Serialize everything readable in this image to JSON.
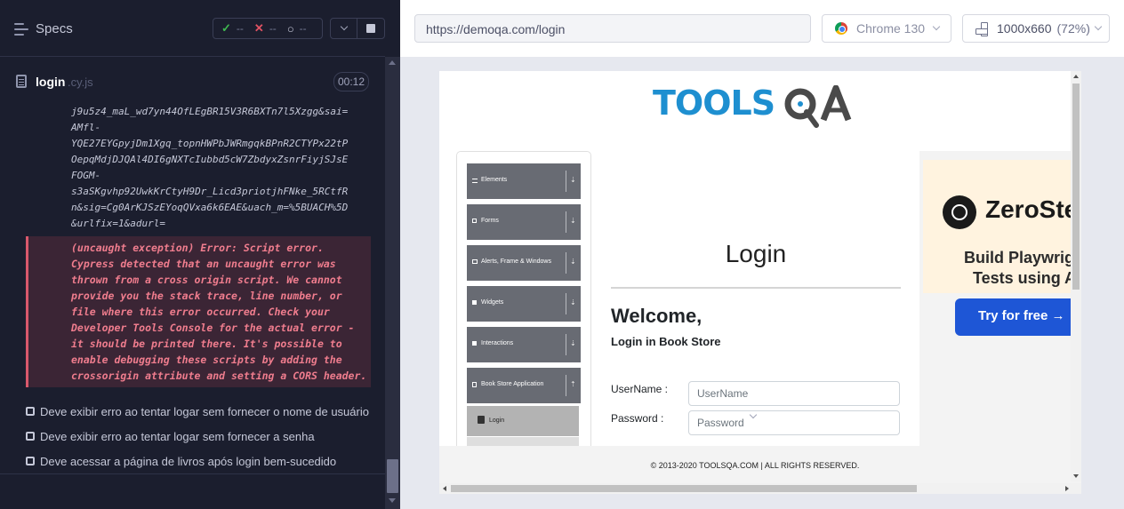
{
  "runner": {
    "title": "Specs",
    "stats": {
      "passed": "--",
      "failed": "--",
      "pending": "--"
    },
    "spec": {
      "name": "login",
      "ext": ".cy.js",
      "timer": "00:12"
    },
    "log_lines": [
      "j9u5z4_maL_wd7yn44OfLEgBR15V3R6BXTn7l5Xzgg&sai=",
      "AMfl-",
      "YQE27EYGpyjDm1Xgq_topnHWPbJWRmgqkBPnR2CTYPx22tP",
      "OepqMdjDJQAl4DI6gNXTcIubbd5cW7ZbdyxZsnrFiyjSJsE",
      "FOGM-",
      "s3aSKgvhp92UwkKrCtyH9Dr_Licd3priotjhFNke_5RCtfR",
      "n&sig=Cg0ArKJSzEYoqQVxa6k6EAE&uach_m=%5BUACH%5D",
      "&urlfix=1&adurl="
    ],
    "error_lines": [
      "(uncaught exception)  Error: Script error.",
      "Cypress detected that an uncaught error was",
      "thrown from a cross origin script. We cannot",
      "provide you the stack trace, line number, or",
      "file where this error occurred. Check your",
      "Developer Tools Console for the actual error -",
      "it should be printed there. It's possible to",
      "enable debugging these scripts by adding the",
      "crossorigin attribute and setting a CORS header."
    ],
    "tests": [
      "Deve exibir erro ao tentar logar sem fornecer o nome de usuário",
      "Deve exibir erro ao tentar logar sem fornecer a senha",
      "Deve acessar a página de livros após login bem-sucedido"
    ],
    "colors": {
      "pass": "#3fb950",
      "fail": "#e05263",
      "pending": "#c5c8d8"
    }
  },
  "preview": {
    "url": "https://demoqa.com/login",
    "browser": "Chrome 130",
    "viewport": "1000x660",
    "scale": "(72%)"
  },
  "app": {
    "logo": {
      "text": "TOOLS",
      "accent": "A"
    },
    "menu": [
      {
        "label": "Elements",
        "icon": "list-icon"
      },
      {
        "label": "Forms",
        "icon": "forms-icon"
      },
      {
        "label": "Alerts, Frame & Windows",
        "icon": "window-icon"
      },
      {
        "label": "Widgets",
        "icon": "grid-icon"
      },
      {
        "label": "Interactions",
        "icon": "grid-icon"
      },
      {
        "label": "Book Store Application",
        "icon": "book-icon"
      }
    ],
    "submenu_active": "Login",
    "page_title": "Login",
    "welcome": "Welcome,",
    "subtitle": "Login in Book Store",
    "fields": {
      "username_label": "UserName :",
      "username_placeholder": "UserName",
      "password_label": "Password :",
      "password_placeholder": "Password"
    },
    "footer": "© 2013-2020 TOOLSQA.COM | ALL RIGHTS RESERVED.",
    "ad": {
      "brand": "ZeroStep",
      "line1": "Build Playwright",
      "line2": "Tests using AI",
      "button": "Try for free →"
    }
  }
}
